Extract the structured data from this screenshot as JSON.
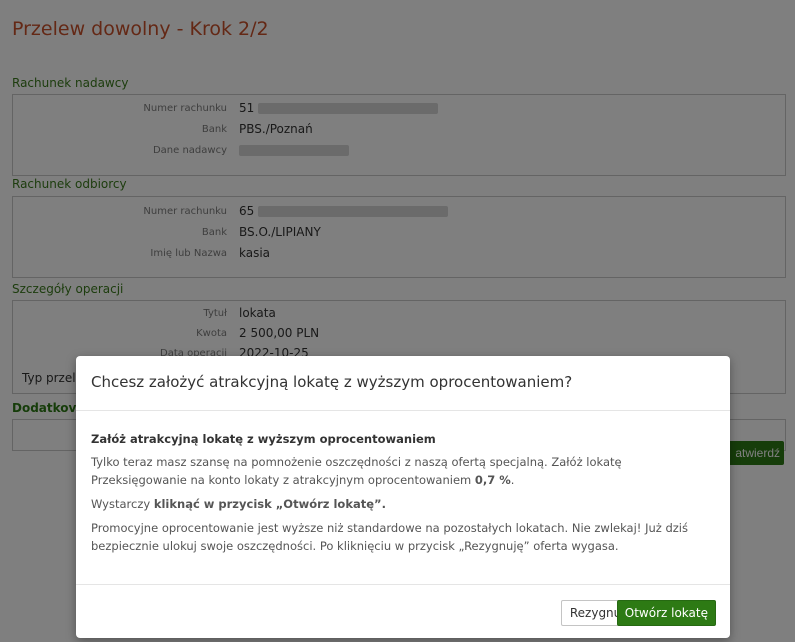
{
  "page": {
    "title": "Przelew dowolny - Krok 2/2",
    "confirm_label": "atwierdź"
  },
  "sender": {
    "header": "Rachunek nadawcy",
    "rows": [
      {
        "label": "Numer rachunku",
        "value": "51"
      },
      {
        "label": "Bank",
        "value": "PBS./Poznań"
      },
      {
        "label": "Dane nadawcy",
        "value": ""
      }
    ]
  },
  "recipient": {
    "header": "Rachunek odbiorcy",
    "rows": [
      {
        "label": "Numer rachunku",
        "value": "65"
      },
      {
        "label": "Bank",
        "value": "BS.O./LIPIANY"
      },
      {
        "label": "Imię lub Nazwa",
        "value": "kasia"
      }
    ]
  },
  "details": {
    "header": "Szczegóły operacji",
    "rows": [
      {
        "label": "Tytuł",
        "value": "lokata"
      },
      {
        "label": "Kwota",
        "value": "2 500,00 PLN"
      },
      {
        "label": "Data operacji",
        "value": "2022-10-25"
      }
    ],
    "type_label": "Typ przel",
    "extra_header": "Dodatkov"
  },
  "modal": {
    "title": "Chcesz założyć atrakcyjną lokatę z wyższym oprocentowaniem?",
    "lead": "Załóż atrakcyjną lokatę z wyższym oprocentowaniem",
    "p1_text": "Tylko teraz masz szansę na pomnożenie oszczędności z naszą ofertą specjalną. Załóż lokatę Przeksięgowanie na konto lokaty z atrakcyjnym oprocentowaniem ",
    "p1_rate": "0,7 %",
    "p1_end": ".",
    "p2_text": "Wystarczy ",
    "p2_bold": "kliknąć w przycisk „Otwórz lokatę”.",
    "p3_text": "Promocyjne oprocentowanie jest wyższe niż standardowe na pozostałych lokatach. Nie zwlekaj! Już dziś bezpiecznie ulokuj swoje oszczędności. Po kliknięciu w przycisk „Rezygnuję” oferta wygasa.",
    "cancel_label": "Rezygnuję",
    "open_label": "Otwórz lokatę"
  },
  "colors": {
    "accent_green": "#2d7a14",
    "title_orange": "#c8502b"
  }
}
